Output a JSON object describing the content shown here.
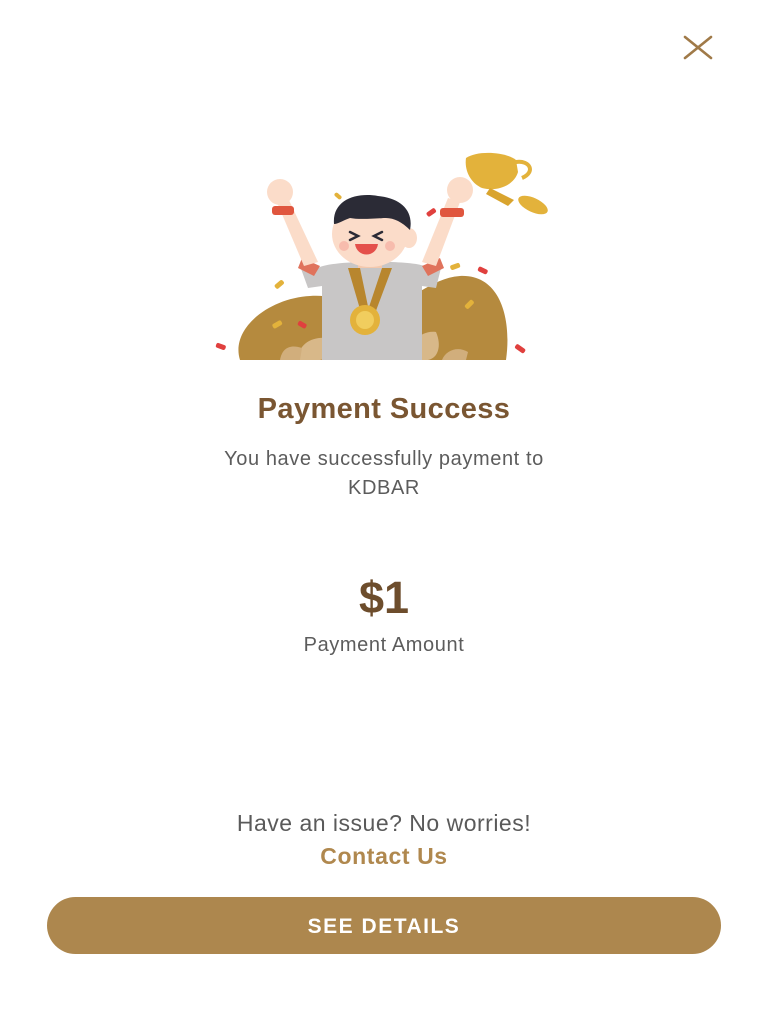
{
  "header": {
    "close_icon": "close-icon"
  },
  "hero": {
    "illustration": "celebrating-person-with-trophy-illustration"
  },
  "result": {
    "title": "Payment Success",
    "subtitle_line1": "You have successfully payment to",
    "subtitle_line2": "KDBAR"
  },
  "payment": {
    "amount": "$1",
    "amount_label": "Payment Amount"
  },
  "support": {
    "issue_text": "Have an issue? No worries!",
    "contact_label": "Contact Us"
  },
  "actions": {
    "see_details_label": "SEE DETAILS"
  },
  "colors": {
    "accent": "#ad874e",
    "title": "#7a5632",
    "amount": "#6d4d2c",
    "body_text": "#5c5c5c",
    "background": "#ffffff"
  }
}
